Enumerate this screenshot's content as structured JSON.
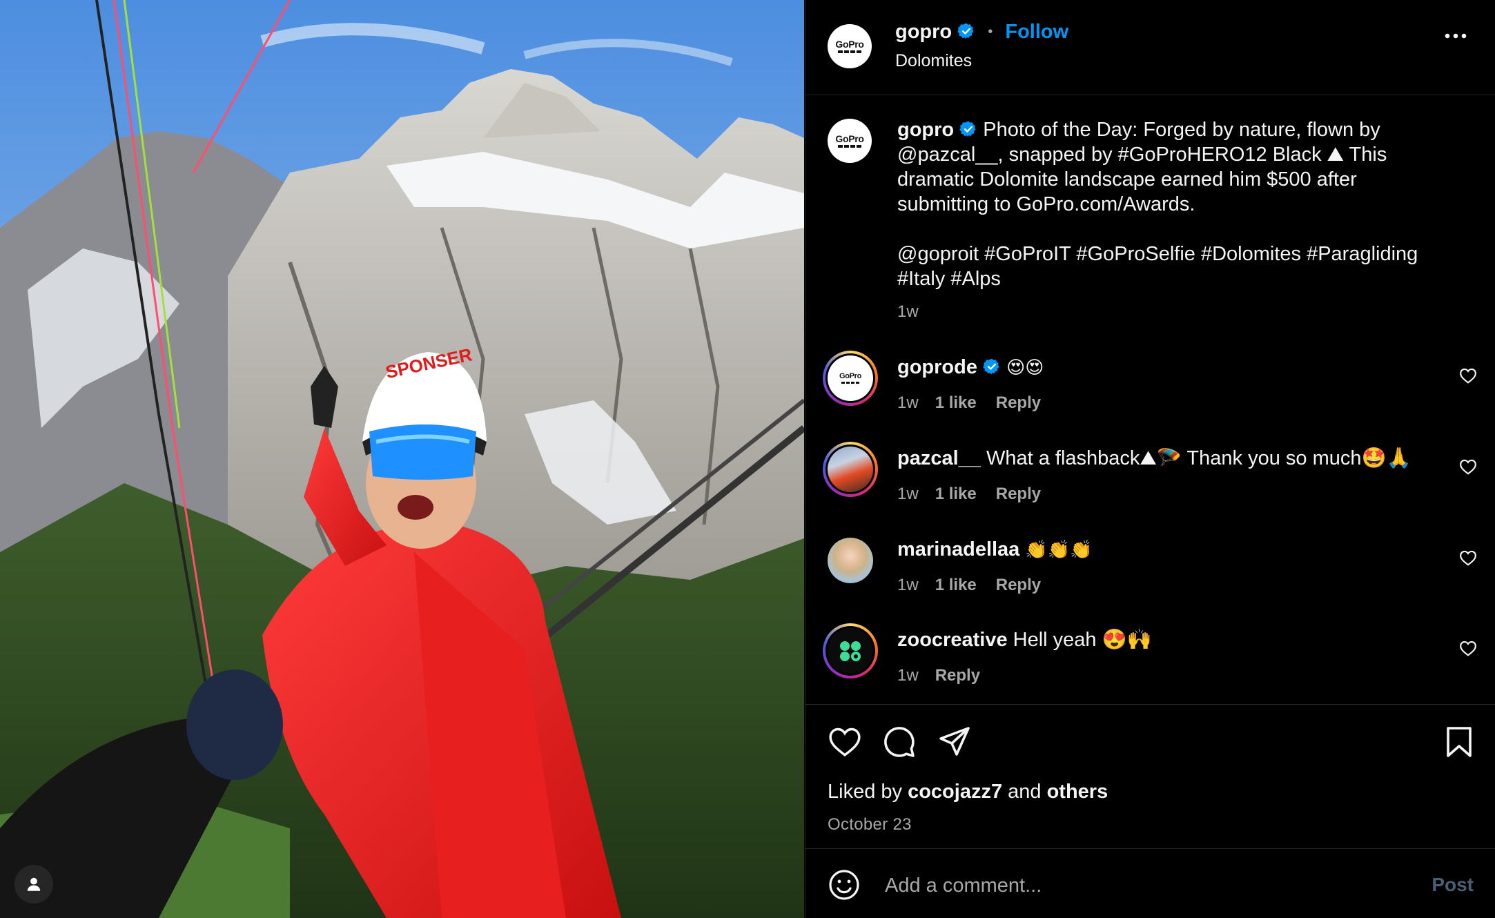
{
  "post": {
    "username": "gopro",
    "follow_label": "Follow",
    "separator": "•",
    "location": "Dolomites",
    "avatar_logo_text": "GoPro"
  },
  "caption": {
    "username": "gopro",
    "line1": "Photo of the Day: Forged by nature, flown by",
    "line2": "@pazcal__, snapped by #GoProHERO12 Black ⛰ This",
    "line3": "dramatic Dolomite landscape earned him $500 after",
    "line4": "submitting to GoPro.com/Awards.",
    "line5": "@goproit #GoProIT #GoProSelfie #Dolomites #Paragliding",
    "line6": "#Italy #Alps",
    "time": "1w"
  },
  "comments": [
    {
      "username": "goprode",
      "text": "😍😍",
      "time": "1w",
      "likes": "1 like",
      "reply": "Reply",
      "avatar": "gopro-logo",
      "verified": true
    },
    {
      "username": "pazcal__",
      "text": "What a flashback⛰🪂 Thank you so much🤩🙏",
      "time": "1w",
      "likes": "1 like",
      "reply": "Reply",
      "avatar": "photo-red-jacket",
      "verified": false
    },
    {
      "username": "marinadellaa",
      "text": "👏👏👏",
      "time": "1w",
      "likes": "1 like",
      "reply": "Reply",
      "avatar": "photo-blonde",
      "verified": false
    },
    {
      "username": "zoocreative",
      "text": "Hell yeah 😍🙌",
      "time": "1w",
      "likes": "",
      "reply": "Reply",
      "avatar": "zoo-logo",
      "verified": false
    }
  ],
  "likes": {
    "prefix": "Liked by",
    "user": "cocojazz7",
    "conj": "and",
    "others": "others",
    "date": "October 23"
  },
  "composer": {
    "placeholder": "Add a comment...",
    "post_label": "Post"
  },
  "icons": [
    "more-icon",
    "verified-icon",
    "heart-icon",
    "comment-icon",
    "share-icon",
    "bookmark-icon",
    "emoji-icon",
    "user-tag-icon"
  ],
  "colors": {
    "accent": "#0095f6",
    "background": "#000000",
    "muted": "#a8a8a8",
    "post_disabled": "#4a5f76"
  }
}
